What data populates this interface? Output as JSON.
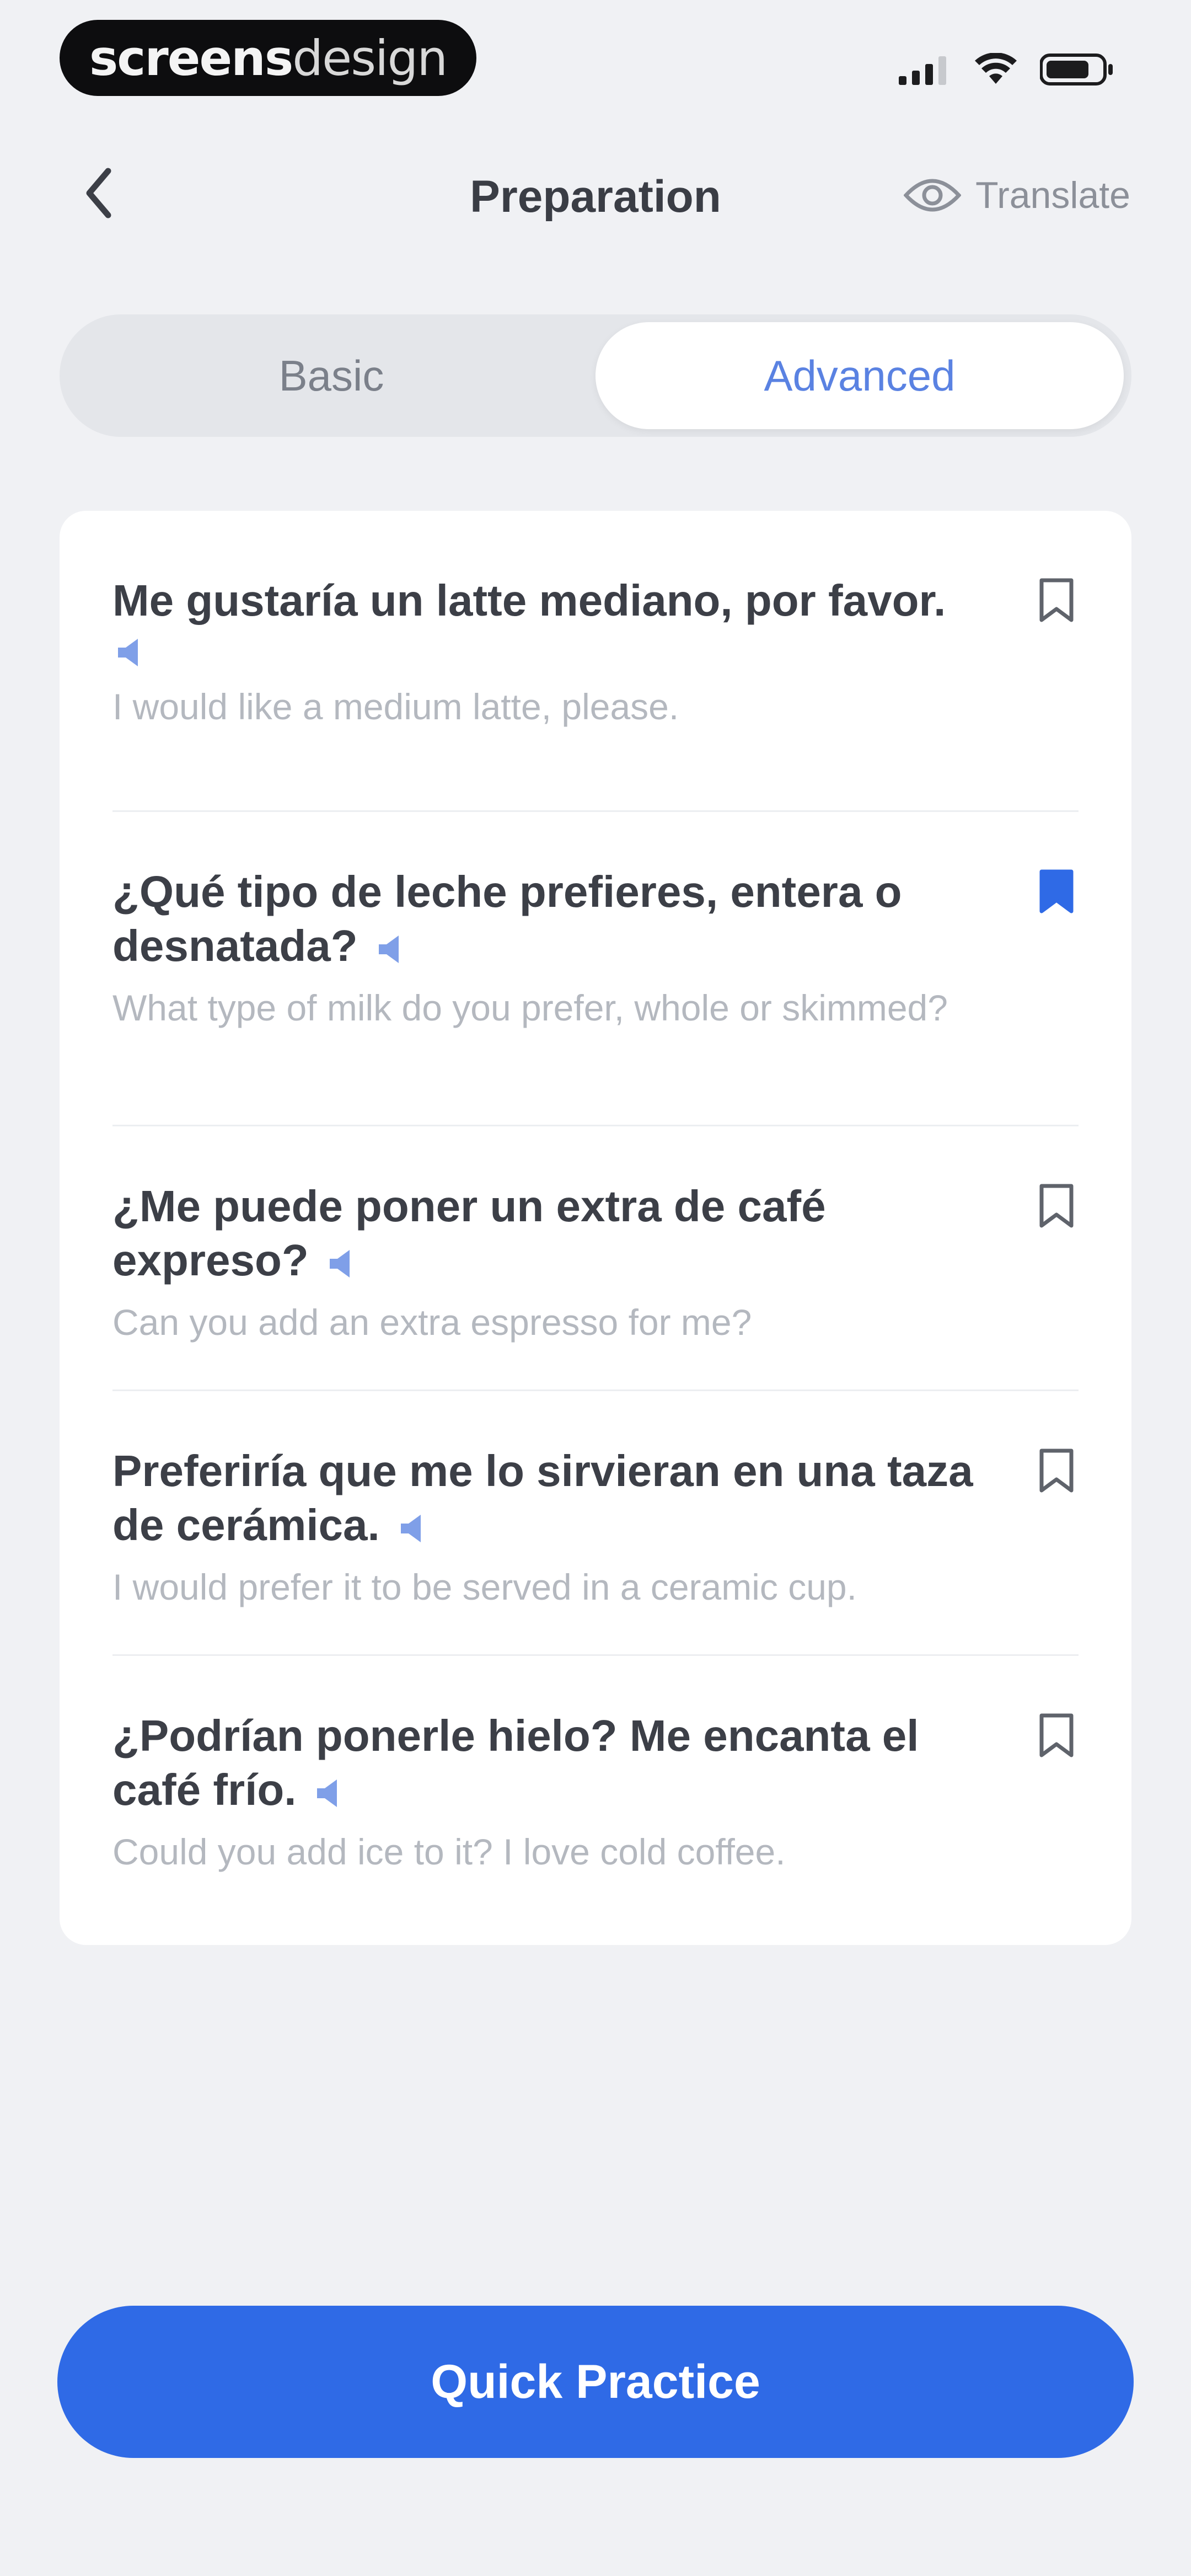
{
  "status_bar": {
    "brand_bold": "screens",
    "brand_light": "design"
  },
  "nav": {
    "title": "Preparation",
    "translate_label": "Translate",
    "back_icon": "chevron-left-icon",
    "translate_icon": "eye-icon"
  },
  "tabs": {
    "basic": "Basic",
    "advanced": "Advanced",
    "active": "Advanced"
  },
  "phrases": [
    {
      "spanish": "Me gustaría un latte mediano, por favor.",
      "english": "I would like a medium latte, please.",
      "bookmarked": false
    },
    {
      "spanish": "¿Qué tipo de leche prefieres, entera o desnatada?",
      "english": "What type of milk do you prefer, whole or skimmed?",
      "bookmarked": true
    },
    {
      "spanish": "¿Me puede poner un extra de café expreso?",
      "english": "Can you add an extra espresso for me?",
      "bookmarked": false
    },
    {
      "spanish": "Preferiría que me lo sirvieran en una taza de cerámica.",
      "english": "I would prefer it to be served in a ceramic cup.",
      "bookmarked": false
    },
    {
      "spanish": "¿Podrían ponerle hielo? Me encanta el café frío.",
      "english": "Could you add ice to it? I love cold coffee.",
      "bookmarked": false
    }
  ],
  "footer": {
    "cta_label": "Quick Practice"
  },
  "colors": {
    "accent": "#2f6ae6",
    "tab_active_text": "#5a82e2",
    "background": "#f0f1f4"
  }
}
